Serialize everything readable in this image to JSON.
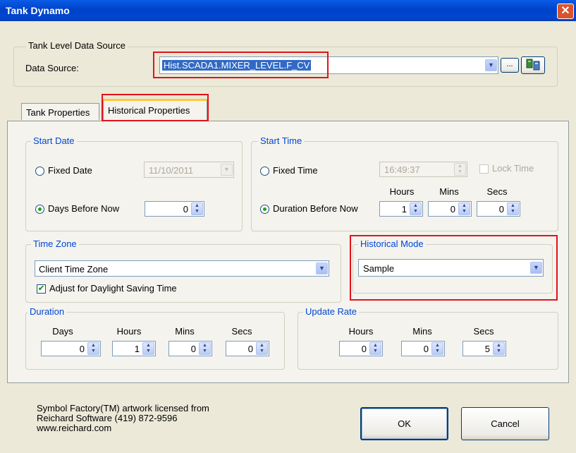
{
  "window": {
    "title": "Tank Dynamo",
    "close_glyph": "✕"
  },
  "data_source": {
    "group_label": "Tank Level Data Source",
    "label": "Data Source:",
    "value": "Hist.SCADA1.MIXER_LEVEL.F_CV",
    "browse_label": "..."
  },
  "tabs": [
    {
      "label": "Tank Properties",
      "selected": false
    },
    {
      "label": "Historical Properties",
      "selected": true
    }
  ],
  "start_date": {
    "group_label": "Start Date",
    "fixed_label": "Fixed Date",
    "fixed_value": "11/10/2011",
    "days_label": "Days Before Now",
    "days_value": "0",
    "selected": "days_before_now"
  },
  "start_time": {
    "group_label": "Start Time",
    "fixed_label": "Fixed Time",
    "fixed_value": "16:49:37",
    "lock_label": "Lock Time",
    "duration_label": "Duration Before Now",
    "hours_header": "Hours",
    "mins_header": "Mins",
    "secs_header": "Secs",
    "hours": "1",
    "mins": "0",
    "secs": "0",
    "selected": "duration_before_now"
  },
  "time_zone": {
    "group_label": "Time Zone",
    "value": "Client Time Zone",
    "dst_label": "Adjust for Daylight Saving Time",
    "dst_checked": true
  },
  "historical_mode": {
    "group_label": "Historical Mode",
    "value": "Sample"
  },
  "duration": {
    "group_label": "Duration",
    "days_header": "Days",
    "hours_header": "Hours",
    "mins_header": "Mins",
    "secs_header": "Secs",
    "days": "0",
    "hours": "1",
    "mins": "0",
    "secs": "0"
  },
  "update_rate": {
    "group_label": "Update Rate",
    "hours_header": "Hours",
    "mins_header": "Mins",
    "secs_header": "Secs",
    "hours": "0",
    "mins": "0",
    "secs": "5"
  },
  "footer": {
    "license_line1": "Symbol Factory(TM) artwork licensed from",
    "license_line2": "Reichard Software (419) 872-9596",
    "license_line3": "www.reichard.com",
    "ok_label": "OK",
    "cancel_label": "Cancel"
  },
  "colors": {
    "highlight_red": "#e2131b",
    "group_blue": "#0046d5",
    "title_blue": "#0042c8"
  }
}
